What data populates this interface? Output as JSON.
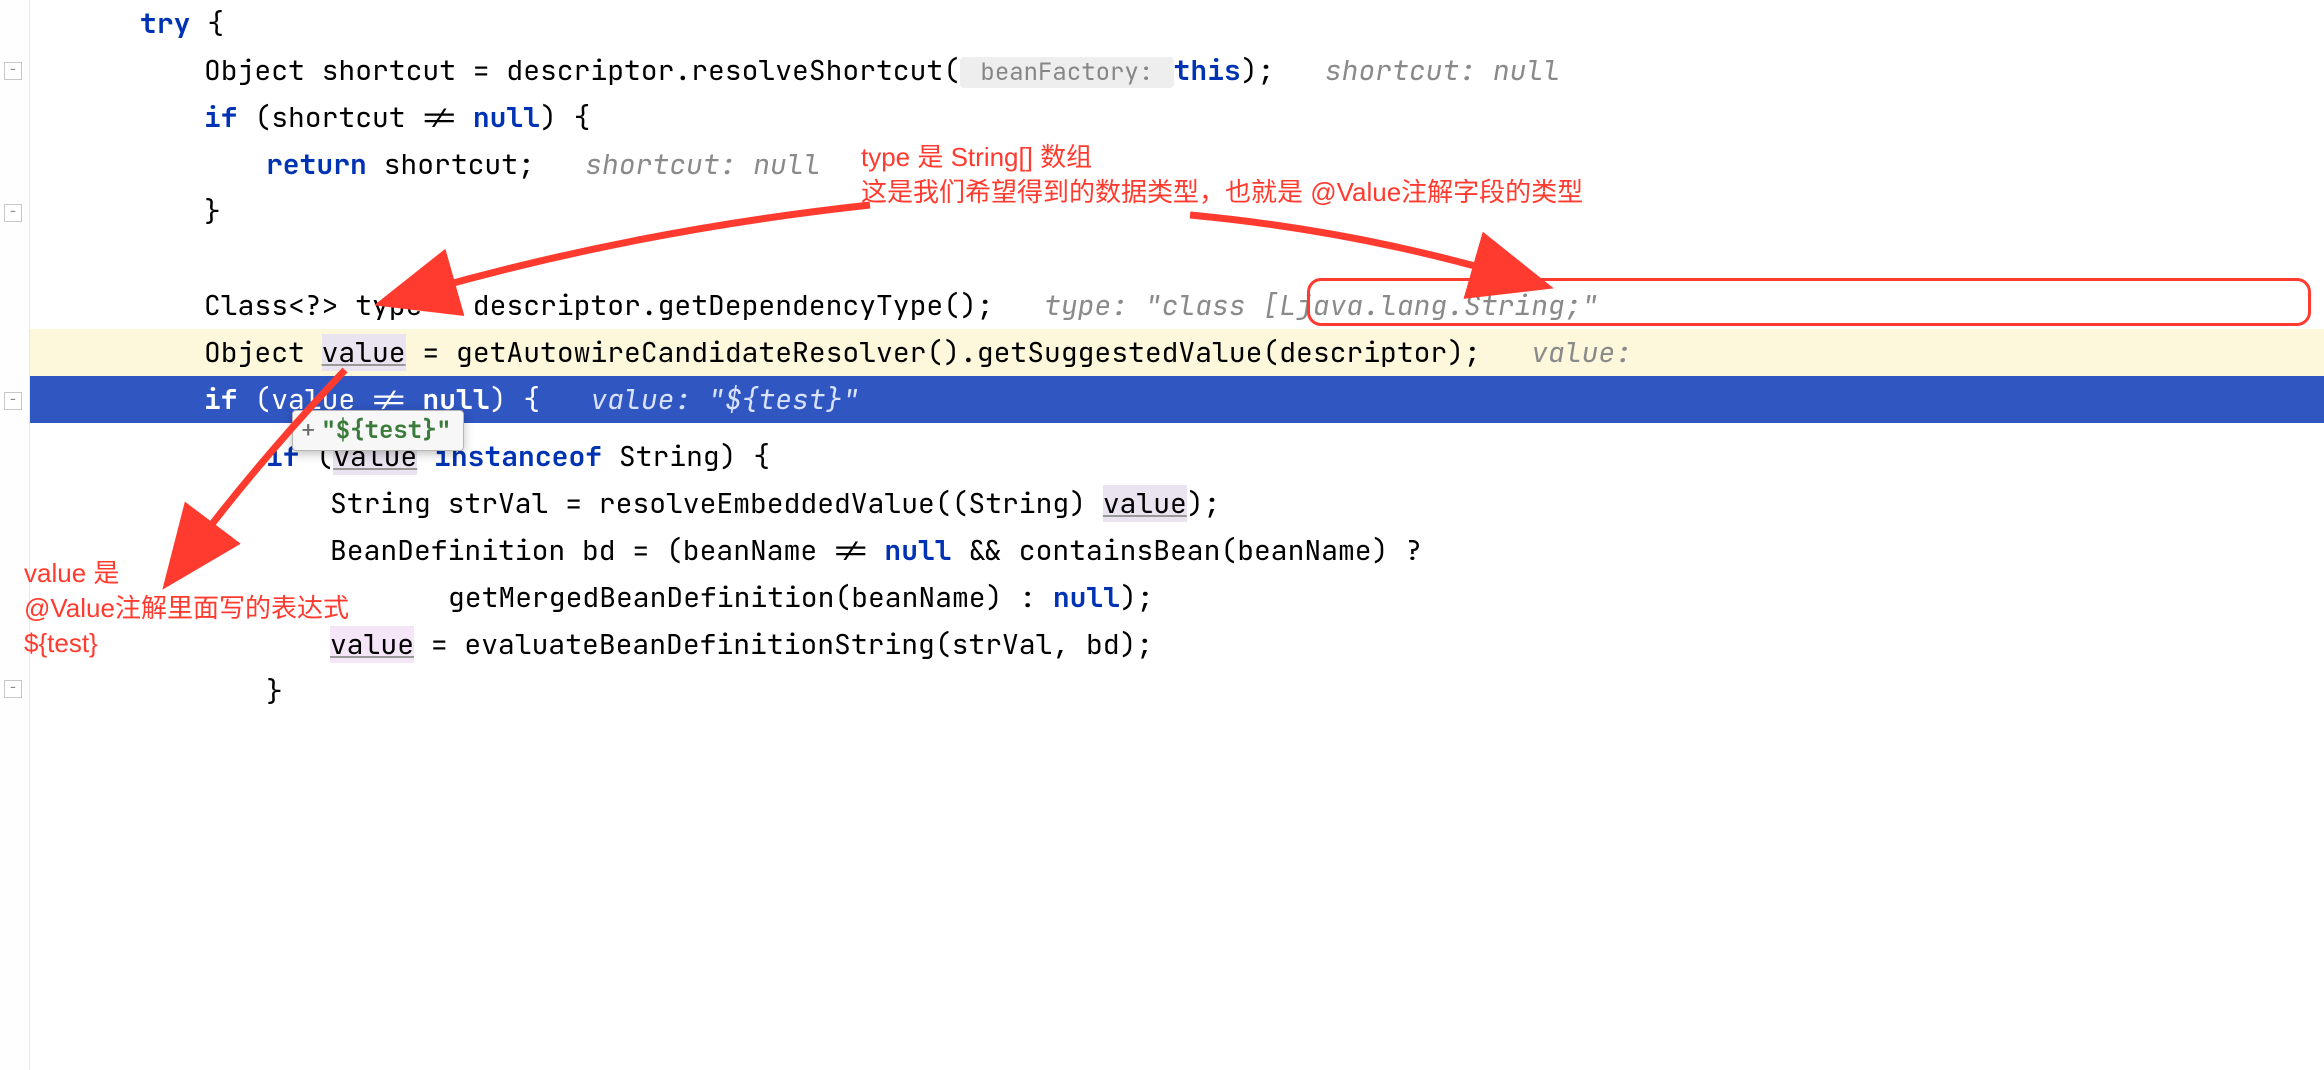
{
  "code": {
    "l1_try": "try",
    "l1_brace": " {",
    "l2_pre": "Object shortcut = descriptor.resolveShortcut(",
    "l2_param": " beanFactory: ",
    "l2_this": "this",
    "l2_post": ");   ",
    "l2_hint": "shortcut: null",
    "l3_if": "if",
    "l3_cond_a": " (shortcut != ",
    "l3_null": "null",
    "l3_cond_b": ") {",
    "l4_return": "return",
    "l4_rest": " shortcut;   ",
    "l4_hint": "shortcut: null",
    "l5": "}",
    "l7": "Class<?> type = descriptor.getDependencyType();   ",
    "l7_hint": "type: \"class [Ljava.lang.String;\"",
    "l8_a": "Object ",
    "l8_value": "value",
    "l8_b": " = getAutowireCandidateResolver().getSuggestedValue(descriptor);   ",
    "l8_hint": "value:",
    "l9_if": "if",
    "l9_a": " (value != ",
    "l9_null": "null",
    "l9_b": ") {   ",
    "l9_hint": "value: \"${test}\"",
    "l10_if": "if",
    "l10_a": " (",
    "l10_value": "value",
    "l10_b": " ",
    "l10_instanceof": "instanceof",
    "l10_c": " String) {",
    "l11_a": "String strVal = resolveEmbeddedValue((String) ",
    "l11_value": "value",
    "l11_b": ");",
    "l12_a": "BeanDefinition bd = (beanName != ",
    "l12_null": "null",
    "l12_b": " && containsBean(beanName) ?",
    "l13_a": "getMergedBeanDefinition(beanName) : ",
    "l13_null": "null",
    "l13_b": ");",
    "l14_value": "value",
    "l14_a": " = evaluateBeanDefinitionString(strVal, bd);",
    "l15": "}"
  },
  "tooltip": {
    "plus": "+",
    "text": "\"${test}\""
  },
  "annotations": {
    "type_note": "type 是 String[] 数组\n这是我们希望得到的数据类型，也就是 @Value注解字段的类型",
    "value_note": "value 是\n@Value注解里面写的表达式\n${test}"
  }
}
